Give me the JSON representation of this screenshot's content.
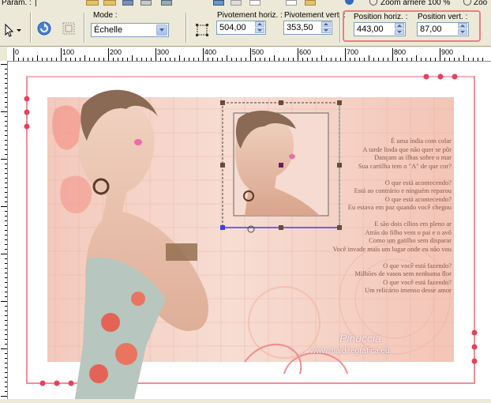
{
  "menu": {
    "param_label": "Param. :",
    "zoom_out_label": "Zoom arrière 100 %",
    "zoom_label": "Zoo"
  },
  "toolbar": {
    "mode_label": "Mode :",
    "mode_value": "Échelle",
    "pivot_h_label": "Pivotement horiz. :",
    "pivot_h_value": "504,00",
    "pivot_v_label": "Pivotement vert. :",
    "pivot_v_value": "353,50",
    "pos_h_label": "Position horiz. :",
    "pos_h_value": "443,00",
    "pos_v_label": "Position vert. :",
    "pos_v_value": "87,00"
  },
  "ruler": {
    "ticks": [
      "0",
      "100",
      "200",
      "300",
      "400",
      "500",
      "600",
      "700",
      "800",
      "900"
    ]
  },
  "poem": [
    "É uma índia com colar",
    "A tarde linda que não quer se pôr",
    "Dançam as ilhas sobre o mar",
    "Sua cartilha tem o \"A\" de que cor?",
    "",
    "O que está acontecendo?",
    "Está ao contrário e ninguém reparou",
    "O que está acontecendo?",
    "Eu estava em paz quando você chegou",
    "",
    "E são dois cílios em pleno ar",
    "Atrás do filho vem o pai e o avô",
    "Como um gatilho sem disparar",
    "Você invade mais um lugar onde eu não vou",
    "",
    "O que você está fazendo?",
    "Milhões de vasos sem nenhuma flor",
    "O que você está fazendo?",
    "Um relicário imenso desse amor"
  ],
  "watermark": {
    "name": "Pinuccia",
    "site": "www.maidiregrafica.eu"
  },
  "colors": {
    "highlight": "#f07c7c",
    "frame_red": "#e8405a",
    "accent_blue": "#316ac5"
  }
}
